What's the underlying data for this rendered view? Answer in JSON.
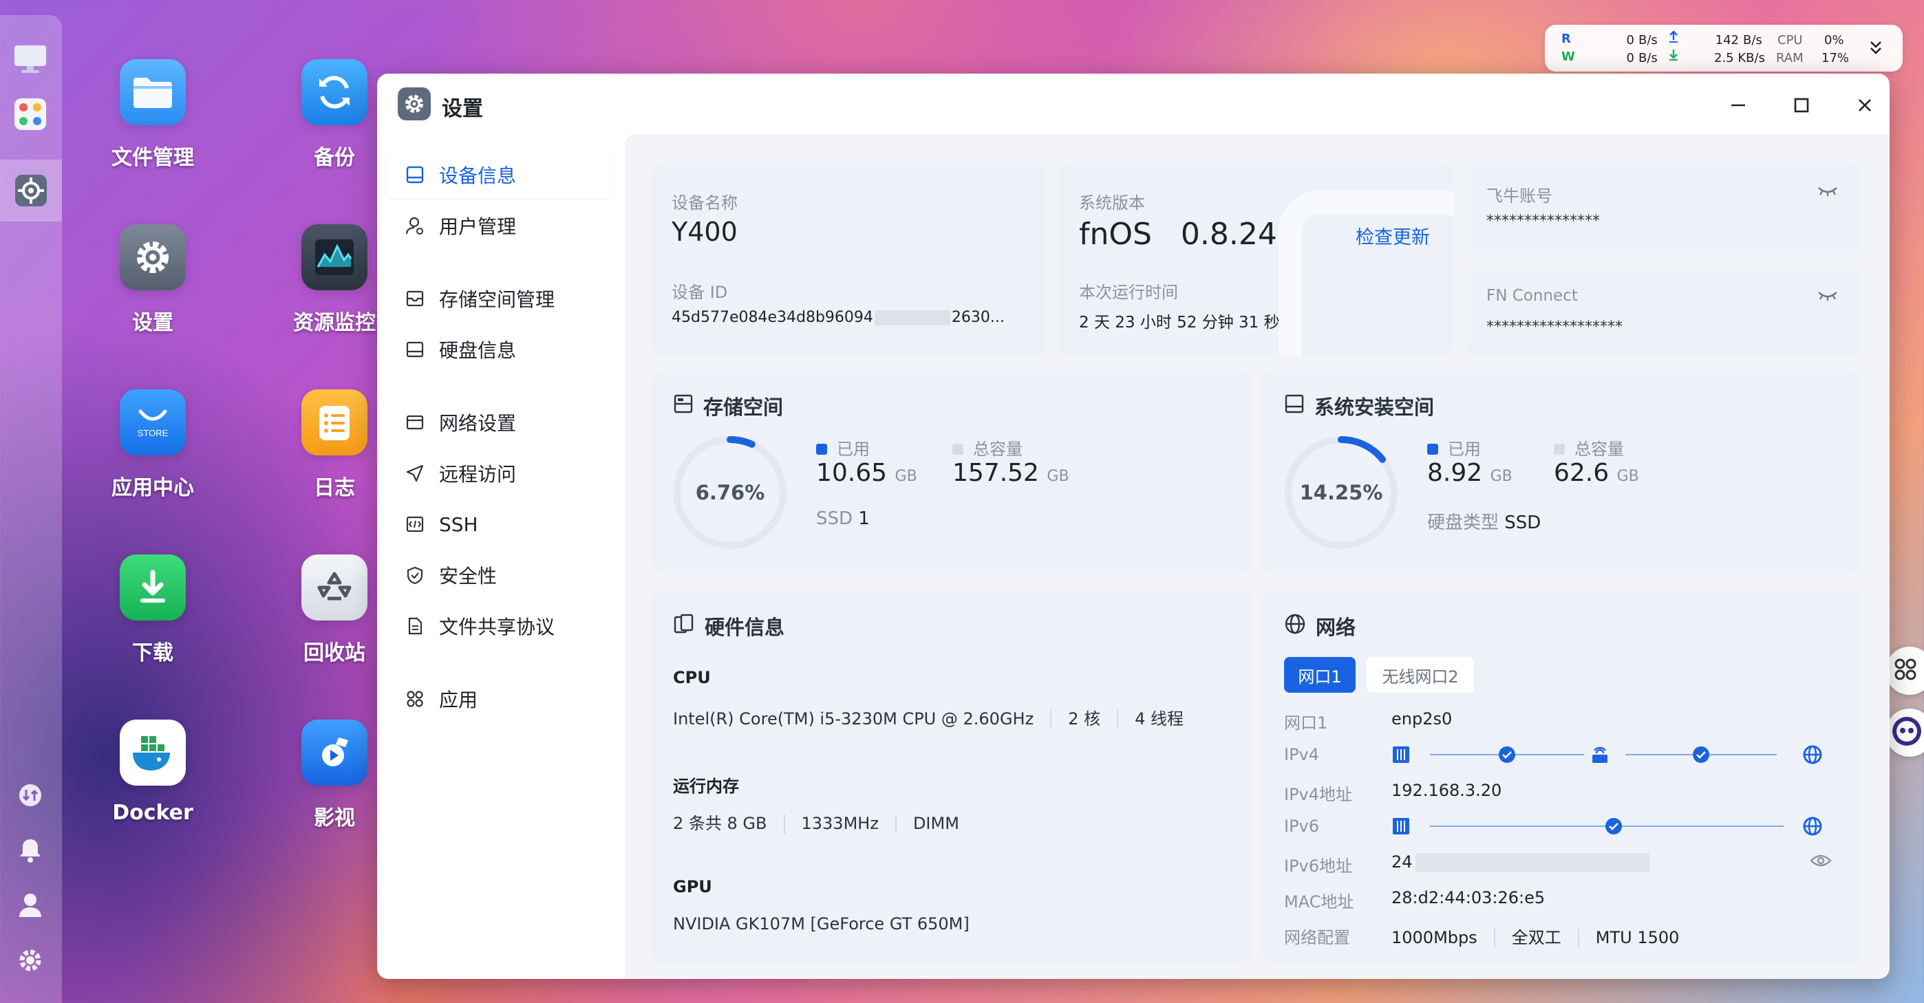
{
  "desktop": {
    "icons": [
      {
        "label": "文件管理",
        "icon": "folder-icon"
      },
      {
        "label": "备份",
        "icon": "backup-icon"
      },
      {
        "label": "设置",
        "icon": "settings-gear-icon"
      },
      {
        "label": "资源监控",
        "icon": "resource-monitor-icon"
      },
      {
        "label": "应用中心",
        "icon": "app-store-icon",
        "badge": "STORE"
      },
      {
        "label": "日志",
        "icon": "log-icon"
      },
      {
        "label": "下载",
        "icon": "download-icon"
      },
      {
        "label": "回收站",
        "icon": "recycle-bin-icon"
      },
      {
        "label": "Docker",
        "icon": "docker-icon"
      },
      {
        "label": "影视",
        "icon": "video-icon"
      }
    ]
  },
  "tray": {
    "r_label": "R",
    "w_label": "W",
    "read_value": "0",
    "read_unit": "B/s",
    "write_value": "0",
    "write_unit": "B/s",
    "up_value": "142",
    "up_unit": "B/s",
    "down_value": "2.5 KB/s",
    "cpu_label": "CPU",
    "ram_label": "RAM",
    "cpu_value": "0%",
    "ram_value": "17%"
  },
  "window": {
    "title": "设置"
  },
  "nav": {
    "items": [
      {
        "label": "设备信息",
        "icon": "device-info-icon",
        "active": true
      },
      {
        "label": "用户管理",
        "icon": "user-icon"
      },
      {
        "label": "存储空间管理",
        "icon": "storage-icon"
      },
      {
        "label": "硬盘信息",
        "icon": "disk-icon"
      },
      {
        "label": "网络设置",
        "icon": "network-settings-icon"
      },
      {
        "label": "远程访问",
        "icon": "remote-access-icon"
      },
      {
        "label": "SSH",
        "icon": "ssh-icon"
      },
      {
        "label": "安全性",
        "icon": "security-shield-icon"
      },
      {
        "label": "文件共享协议",
        "icon": "file-share-icon"
      },
      {
        "label": "应用",
        "icon": "apps-icon"
      }
    ]
  },
  "device": {
    "name_label": "设备名称",
    "name": "Y400",
    "id_label": "设备 ID",
    "id_prefix": "45d577e084e34d8b96094",
    "id_suffix": "2630..."
  },
  "system": {
    "version_label": "系统版本",
    "version": "fnOS   0.8.24",
    "check_update": "检查更新",
    "uptime_label": "本次运行时间",
    "uptime": "2 天 23 小时 52 分钟 31 秒"
  },
  "accounts": {
    "feiniu_label": "飞牛账号",
    "feiniu_value": "***************",
    "fnconnect_label": "FN Connect",
    "fnconnect_value": "******************"
  },
  "storage": {
    "title": "存储空间",
    "percent_text": "6.76%",
    "percent": 6.76,
    "used_label": "已用",
    "used_value": "10.65",
    "used_unit": "GB",
    "total_label": "总容量",
    "total_value": "157.52",
    "total_unit": "GB",
    "ssd_label": "SSD",
    "ssd_value": "1"
  },
  "sys_install": {
    "title": "系统安装空间",
    "percent_text": "14.25%",
    "percent": 14.25,
    "used_label": "已用",
    "used_value": "8.92",
    "used_unit": "GB",
    "total_label": "总容量",
    "total_value": "62.6",
    "total_unit": "GB",
    "disk_type_label": "硬盘类型",
    "disk_type": "SSD"
  },
  "hardware": {
    "title": "硬件信息",
    "cpu_label": "CPU",
    "cpu_model": "Intel(R) Core(TM) i5-3230M CPU @ 2.60GHz",
    "cpu_cores": "2 核",
    "cpu_threads": "4 线程",
    "mem_label": "运行内存",
    "mem_count": "2 条共 8 GB",
    "mem_speed": "1333MHz",
    "mem_type": "DIMM",
    "gpu_label": "GPU",
    "gpu_model": "NVIDIA GK107M [GeForce GT 650M]"
  },
  "network": {
    "title": "网络",
    "tabs": [
      "网口1",
      "无线网口2"
    ],
    "port_label": "网口1",
    "port_value": "enp2s0",
    "ipv4_label": "IPv4",
    "ipv4_addr_label": "IPv4地址",
    "ipv4_addr": "192.168.3.20",
    "ipv6_label": "IPv6",
    "ipv6_addr_label": "IPv6地址",
    "ipv6_addr_prefix": "24",
    "mac_label": "MAC地址",
    "mac": "28:d2:44:03:26:e5",
    "config_label": "网络配置",
    "speed": "1000Mbps",
    "duplex": "全双工",
    "mtu": "MTU 1500"
  },
  "colors": {
    "accent": "#1a63e0",
    "success": "#1f8fff"
  }
}
